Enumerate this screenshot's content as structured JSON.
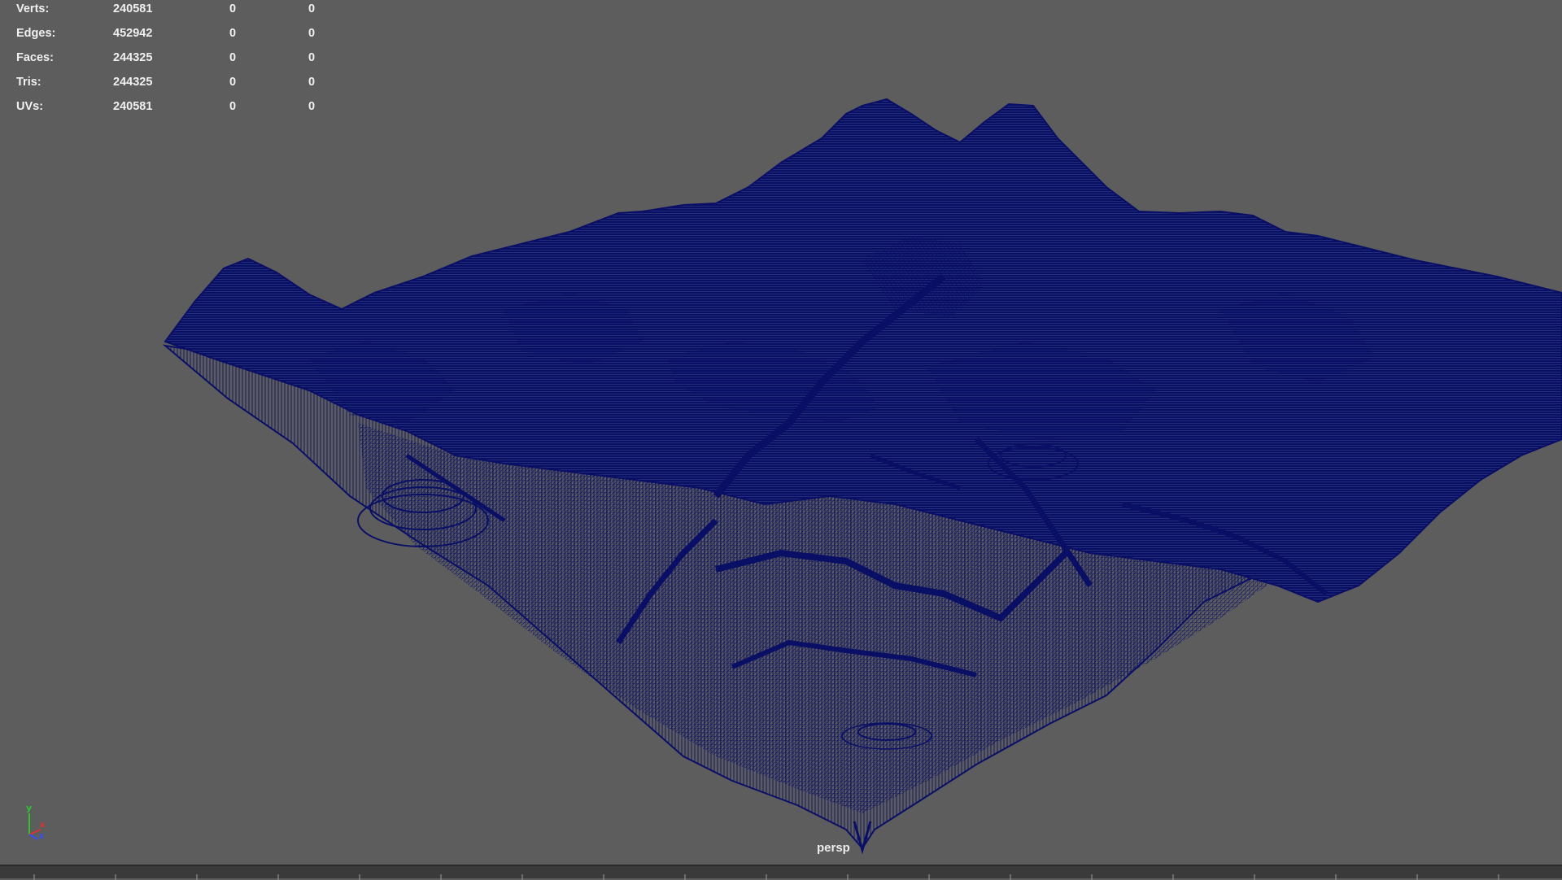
{
  "hud": {
    "rows": [
      {
        "label": "Verts:",
        "total": "240581",
        "selected": "0",
        "component": "0"
      },
      {
        "label": "Edges:",
        "total": "452942",
        "selected": "0",
        "component": "0"
      },
      {
        "label": "Faces:",
        "total": "244325",
        "selected": "0",
        "component": "0"
      },
      {
        "label": "Tris:",
        "total": "244325",
        "selected": "0",
        "component": "0"
      },
      {
        "label": "UVs:",
        "total": "240581",
        "selected": "0",
        "component": "0"
      }
    ]
  },
  "viewport": {
    "camera": "persp",
    "background_color": "#5d5d5d",
    "wireframe_color": "#0a0f66"
  },
  "axis_gizmo": {
    "axes": [
      "y",
      "x",
      "z"
    ],
    "colors": {
      "x": "#e03030",
      "y": "#30c030",
      "z": "#3050ff"
    }
  },
  "icons": {
    "axis": "axis-gizmo-icon"
  }
}
